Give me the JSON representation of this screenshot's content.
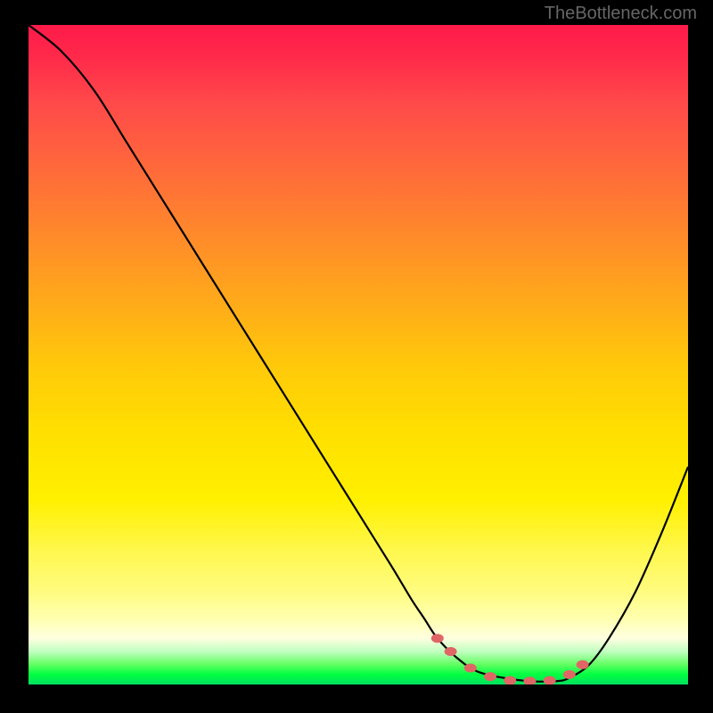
{
  "watermark": "TheBottleneck.com",
  "chart_data": {
    "type": "line",
    "title": "",
    "xlabel": "",
    "ylabel": "",
    "xlim": [
      0,
      100
    ],
    "ylim": [
      0,
      100
    ],
    "series": [
      {
        "name": "bottleneck-curve",
        "x": [
          0,
          5,
          10,
          15,
          20,
          25,
          30,
          35,
          40,
          45,
          50,
          55,
          58,
          60,
          62,
          65,
          68,
          72,
          76,
          80,
          82,
          85,
          88,
          92,
          96,
          100
        ],
        "y": [
          100,
          96,
          90,
          82,
          74,
          66,
          58,
          50,
          42,
          34,
          26,
          18,
          13,
          10,
          7,
          4,
          2,
          1,
          0.5,
          0.5,
          1,
          3,
          7,
          14,
          23,
          33
        ]
      }
    ],
    "markers": {
      "name": "highlight-dots",
      "points": [
        {
          "x": 62,
          "y": 7
        },
        {
          "x": 64,
          "y": 5
        },
        {
          "x": 67,
          "y": 2.5
        },
        {
          "x": 70,
          "y": 1.2
        },
        {
          "x": 73,
          "y": 0.6
        },
        {
          "x": 76,
          "y": 0.5
        },
        {
          "x": 79,
          "y": 0.6
        },
        {
          "x": 82,
          "y": 1.5
        },
        {
          "x": 84,
          "y": 3
        }
      ]
    },
    "gradient_stops": [
      {
        "offset": 0,
        "color": "#ff1a4a"
      },
      {
        "offset": 50,
        "color": "#ffd000"
      },
      {
        "offset": 95,
        "color": "#ffff80"
      },
      {
        "offset": 100,
        "color": "#00e060"
      }
    ]
  }
}
